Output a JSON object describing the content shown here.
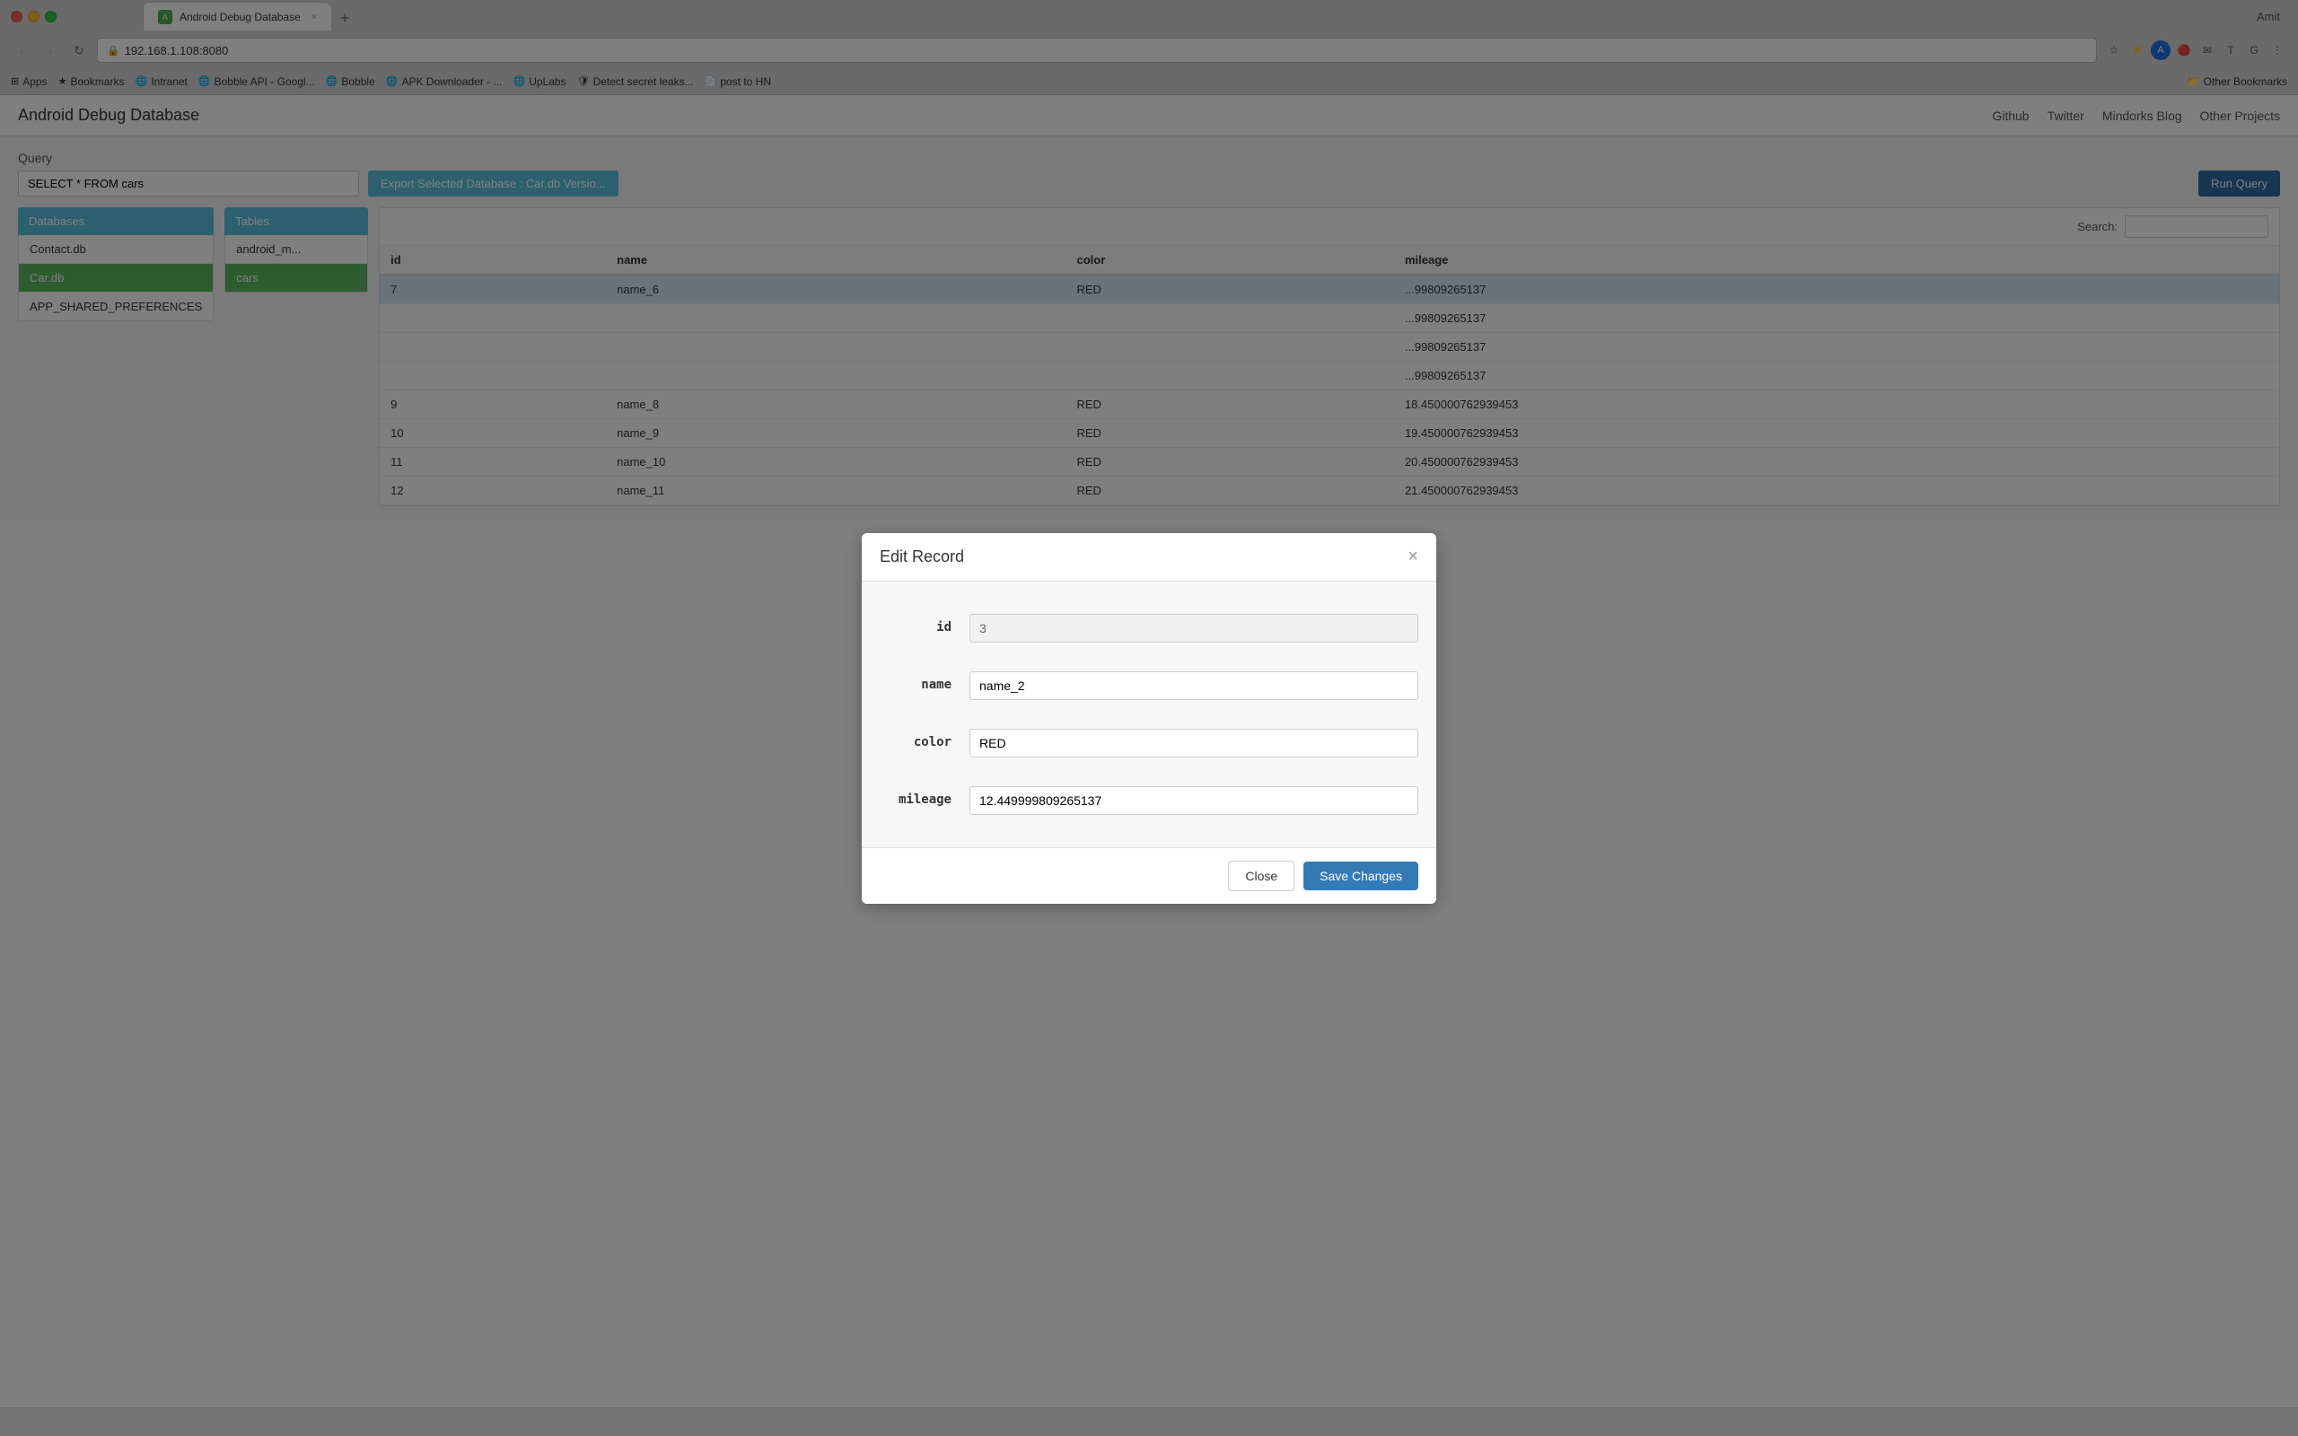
{
  "browser": {
    "tab_title": "Android Debug Database",
    "tab_icon_text": "A",
    "url": "192.168.1.108:8080",
    "url_protocol": "http://",
    "user_initial": "A",
    "user_name": "Amit"
  },
  "bookmarks": {
    "items": [
      {
        "label": "Apps",
        "icon": "⊞"
      },
      {
        "label": "Bookmarks",
        "icon": "★"
      },
      {
        "label": "Intranet",
        "icon": "🌐"
      },
      {
        "label": "Bobble API - Googl...",
        "icon": "🌐"
      },
      {
        "label": "Bobble",
        "icon": "🌐"
      },
      {
        "label": "APK Downloader - ...",
        "icon": "🌐"
      },
      {
        "label": "UpLabs",
        "icon": "🌐"
      },
      {
        "label": "Detect secret leaks...",
        "icon": "🛡"
      },
      {
        "label": "post to HN",
        "icon": "📄"
      }
    ],
    "other_label": "Other Bookmarks",
    "other_icon": "📁"
  },
  "page": {
    "title": "Android Debug Database",
    "nav": {
      "items": [
        "Github",
        "Twitter",
        "Mindorks Blog"
      ],
      "dropdown_label": "Other Projects"
    }
  },
  "query_section": {
    "label": "Query",
    "input_value": "SELECT * FROM cars",
    "export_btn": "Export Selected Database : Car.db Versio...",
    "run_query_btn": "Run Query"
  },
  "databases": {
    "panel_label": "Databases",
    "items": [
      {
        "label": "Contact.db",
        "active": false
      },
      {
        "label": "Car.db",
        "active": true
      },
      {
        "label": "APP_SHARED_PREFERENCES",
        "active": false
      }
    ]
  },
  "tables": {
    "panel_label": "Tables",
    "items": [
      {
        "label": "android_m...",
        "active": false
      },
      {
        "label": "cars",
        "active": true
      }
    ]
  },
  "search": {
    "label": "Search:",
    "placeholder": ""
  },
  "data_table": {
    "columns": [
      "id",
      "name",
      "color",
      "mileage"
    ],
    "rows": [
      {
        "id": "7",
        "name": "name_6",
        "color": "RED",
        "mileage": "..99809265137",
        "highlighted": true
      },
      {
        "id": "",
        "name": "",
        "color": "",
        "mileage": "..99809265137",
        "highlighted": false
      },
      {
        "id": "",
        "name": "",
        "color": "",
        "mileage": "..99809265137",
        "highlighted": false
      },
      {
        "id": "",
        "name": "",
        "color": "",
        "mileage": "..99809265137",
        "highlighted": false
      },
      {
        "id": "9",
        "name": "name_8",
        "color": "RED",
        "mileage": "18.450000762939453",
        "highlighted": false
      },
      {
        "id": "10",
        "name": "name_9",
        "color": "RED",
        "mileage": "19.450000762939453",
        "highlighted": false
      },
      {
        "id": "11",
        "name": "name_10",
        "color": "RED",
        "mileage": "20.450000762939453",
        "highlighted": false
      },
      {
        "id": "12",
        "name": "name_11",
        "color": "RED",
        "mileage": "21.450000762939453",
        "highlighted": false
      }
    ]
  },
  "modal": {
    "title": "Edit Record",
    "fields": [
      {
        "key": "id",
        "value": "3",
        "readonly": true
      },
      {
        "key": "name",
        "value": "name_2",
        "readonly": false
      },
      {
        "key": "color",
        "value": "RED",
        "readonly": false
      },
      {
        "key": "mileage",
        "value": "12.449999809265137",
        "readonly": false
      }
    ],
    "close_btn": "Close",
    "save_btn": "Save Changes"
  }
}
